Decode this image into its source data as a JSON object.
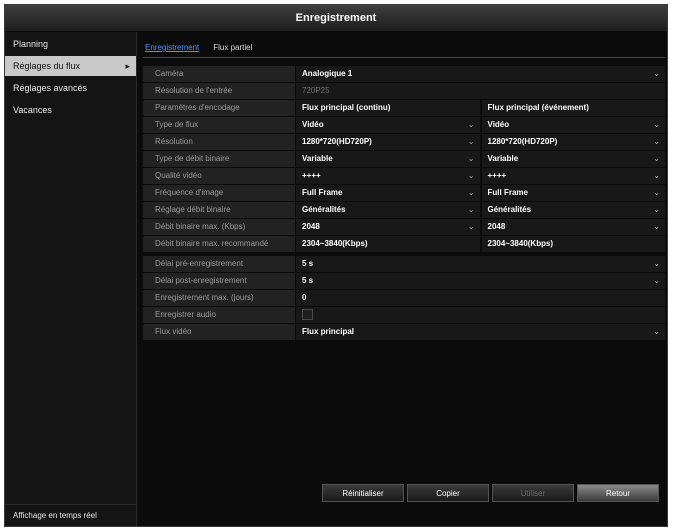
{
  "window": {
    "title": "Enregistrement"
  },
  "sidebar": {
    "items": [
      {
        "label": "Planning"
      },
      {
        "label": "Réglages du flux"
      },
      {
        "label": "Réglages avancés"
      },
      {
        "label": "Vacances"
      }
    ],
    "bottom_label": "Affichage en temps réel"
  },
  "tabs": [
    {
      "label": "Enregistrement"
    },
    {
      "label": "Flux partiel"
    }
  ],
  "form": {
    "camera": {
      "label": "Caméra",
      "value": "Analogique 1"
    },
    "input_resolution": {
      "label": "Résolution de l'entrée",
      "value": "720P25"
    },
    "encoding_params": {
      "label": "Paramètres d'encodage",
      "col1": "Flux principal (continu)",
      "col2": "Flux principal (événement)"
    },
    "stream_type": {
      "label": "Type de flux",
      "col1": "Vidéo",
      "col2": "Vidéo"
    },
    "resolution": {
      "label": "Résolution",
      "col1": "1280*720(HD720P)",
      "col2": "1280*720(HD720P)"
    },
    "bitrate_type": {
      "label": "Type de débit binaire",
      "col1": "Variable",
      "col2": "Variable"
    },
    "video_quality": {
      "label": "Qualité vidéo",
      "col1": "++++",
      "col2": "++++"
    },
    "frame_rate": {
      "label": "Fréquence d'image",
      "col1": "Full Frame",
      "col2": "Full Frame"
    },
    "bitrate_setting": {
      "label": "Réglage débit binaire",
      "col1": "Généralités",
      "col2": "Généralités"
    },
    "max_bitrate": {
      "label": "Débit binaire max. (Kbps)",
      "col1": "2048",
      "col2": "2048"
    },
    "recommended_bitrate": {
      "label": "Débit binaire max. recommandé",
      "col1": "2304~3840(Kbps)",
      "col2": "2304~3840(Kbps)"
    },
    "pre_record": {
      "label": "Délai pré-enregistrement",
      "value": "5 s"
    },
    "post_record": {
      "label": "Délai post-enregistrement",
      "value": "5 s"
    },
    "max_record_days": {
      "label": "Enregistrement max. (jours)",
      "value": "0"
    },
    "record_audio": {
      "label": "Enregistrer audio"
    },
    "video_stream": {
      "label": "Flux vidéo",
      "value": "Flux principal"
    }
  },
  "buttons": {
    "reset": "Réinitialiser",
    "copy": "Copier",
    "use": "Utiliser",
    "back": "Retour"
  },
  "icons": {
    "dropdown": "chevron-down-icon",
    "submenu": "chevron-right-icon"
  },
  "colors": {
    "accent": "#4f95ff",
    "background": "#0b0b0b",
    "active_item": "#c9c9c9"
  }
}
